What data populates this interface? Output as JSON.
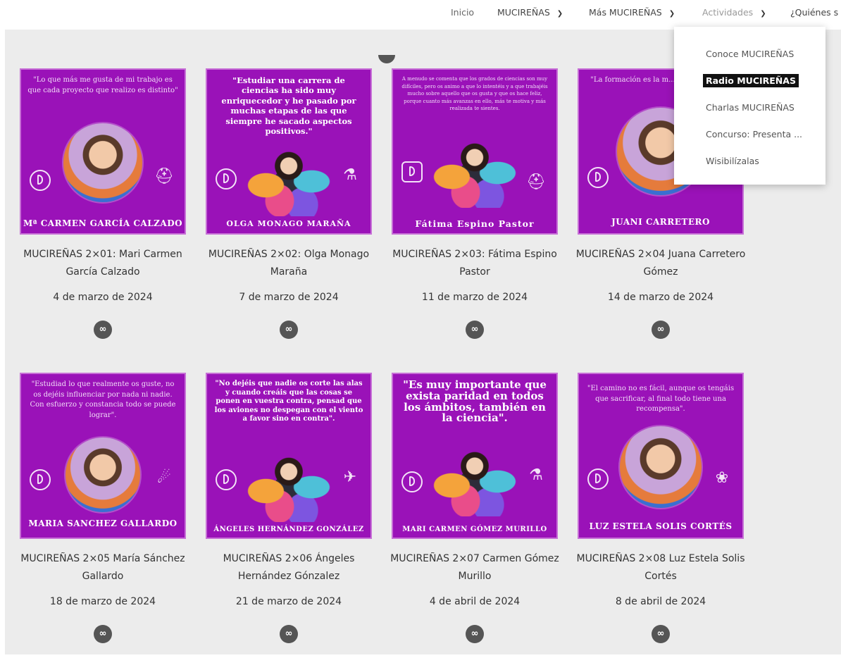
{
  "nav": {
    "items": [
      {
        "label": "Inicio",
        "has_dropdown": false
      },
      {
        "label": "MUCIREÑAS",
        "has_dropdown": true
      },
      {
        "label": "Más MUCIREÑAS",
        "has_dropdown": true
      },
      {
        "label": "Actividades",
        "has_dropdown": true
      },
      {
        "label": "¿Quiénes s",
        "has_dropdown": false
      }
    ],
    "chevron": "⌄"
  },
  "dropdown": {
    "items": [
      {
        "label": "Conoce MUCIREÑAS",
        "active": false
      },
      {
        "label": "Radio MUCIREÑAS",
        "active": true
      },
      {
        "label": "Charlas MUCIREÑAS",
        "active": false
      },
      {
        "label": "Concurso: Presenta ...",
        "active": false
      },
      {
        "label": "Wisibilízalas",
        "active": false
      }
    ]
  },
  "cards": [
    {
      "quote": "\"Lo que más me gusta de mi trabajo es que cada proyecto que realizo es distinto\"",
      "poster_name": "Mª CARMEN GARCÍA CALZADO",
      "title": "MUCIREÑAS 2×01: Mari Carmen García Calzado",
      "date": "4 de marzo de 2024"
    },
    {
      "quote": "\"Estudiar una carrera de ciencias ha sido muy enriquecedor y he pasado por muchas etapas de las que siempre he sacado aspectos positivos.\"",
      "poster_name": "OLGA MONAGO MARAÑA",
      "title": "MUCIREÑAS 2×02: Olga Monago Maraña",
      "date": "7 de marzo de 2024"
    },
    {
      "quote": "A menudo se comenta que los grados de ciencias son muy difíciles, pero os animo a que lo intentéis y a que trabajéis mucho sobre aquello que os gusta y que os hace feliz, porque cuanto más avanzas en ello, más te motiva y más realizada te sientes.",
      "poster_name": "Fátima Espino Pastor",
      "title": "MUCIREÑAS 2×03: Fátima Espino Pastor",
      "date": "11 de marzo de 2024"
    },
    {
      "quote": "\"La formación es la m... cambiar el m...",
      "poster_name": "JUANI CARRETERO",
      "title": "MUCIREÑAS 2×04 Juana Carretero Gómez",
      "date": "14 de marzo de 2024"
    },
    {
      "quote": "\"Estudiad lo que realmente os guste, no os dejéis influenciar por nada ni nadie. Con esfuerzo y constancia todo se puede lograr\".",
      "poster_name": "MARIA SANCHEZ GALLARDO",
      "title": "MUCIREÑAS 2×05 María Sánchez Gallardo",
      "date": "18 de marzo de 2024"
    },
    {
      "quote": "\"No dejéis que nadie os corte las alas y cuando creáis que las cosas se ponen en vuestra contra, pensad que los aviones no despegan con el viento a favor sino en contra\".",
      "poster_name": "ÁNGELES HERNÁNDEZ GONZÁLEZ",
      "title": "MUCIREÑAS 2×06 Ángeles Hernández Gónzalez",
      "date": "21 de marzo de 2024"
    },
    {
      "quote": "\"Es muy importante que exista paridad en todos los ámbitos, también en la ciencia\".",
      "poster_name": "MARI CARMEN GÓMEZ MURILLO",
      "title": "MUCIREÑAS 2×07 Carmen Gómez Murillo",
      "date": "4 de abril de 2024"
    },
    {
      "quote": "\"El camino no es fácil, aunque os tengáis que sacrificar, al final todo tiene una recompensa\".",
      "poster_name": "LUZ ESTELA SOLIS CORTÉS",
      "title": "MUCIREÑAS 2×08 Luz Estela Solis Cortés",
      "date": "8 de abril de 2024"
    }
  ],
  "icons": {
    "link": "link-icon",
    "logo": "logo-icon",
    "helmet": "helmet-icon",
    "flask": "flask-icon",
    "telescope": "telescope-icon",
    "plane": "plane-icon",
    "plant": "plant-icon"
  },
  "colors": {
    "poster_bg": "#9a12b8",
    "content_bg": "#ececec",
    "active_menu_bg": "#111111"
  }
}
